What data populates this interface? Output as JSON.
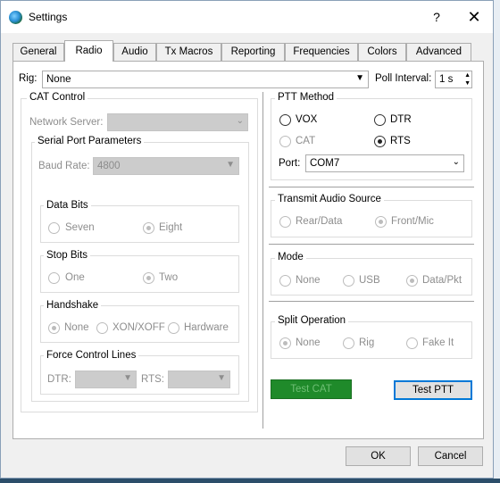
{
  "window": {
    "title": "Settings",
    "help": "?",
    "close": "✕"
  },
  "tabs": [
    "General",
    "Radio",
    "Audio",
    "Tx Macros",
    "Reporting",
    "Frequencies",
    "Colors",
    "Advanced"
  ],
  "rig": {
    "label": "Rig:",
    "value": "None"
  },
  "poll": {
    "label": "Poll Interval:",
    "value": "1 s"
  },
  "cat": {
    "title": "CAT Control",
    "network_label": "Network Server:",
    "serial_title": "Serial Port Parameters",
    "baud_label": "Baud Rate:",
    "baud_value": "4800",
    "data_bits": {
      "title": "Data Bits",
      "opt1": "Seven",
      "opt2": "Eight"
    },
    "stop_bits": {
      "title": "Stop Bits",
      "opt1": "One",
      "opt2": "Two"
    },
    "handshake": {
      "title": "Handshake",
      "opt1": "None",
      "opt2": "XON/XOFF",
      "opt3": "Hardware"
    },
    "force": {
      "title": "Force Control Lines",
      "dtr": "DTR:",
      "rts": "RTS:"
    }
  },
  "ptt": {
    "title": "PTT Method",
    "vox": "VOX",
    "dtr": "DTR",
    "cat": "CAT",
    "rts": "RTS",
    "port_label": "Port:",
    "port_value": "COM7"
  },
  "audio_source": {
    "title": "Transmit Audio Source",
    "opt1": "Rear/Data",
    "opt2": "Front/Mic"
  },
  "mode": {
    "title": "Mode",
    "opt1": "None",
    "opt2": "USB",
    "opt3": "Data/Pkt"
  },
  "split": {
    "title": "Split Operation",
    "opt1": "None",
    "opt2": "Rig",
    "opt3": "Fake It"
  },
  "buttons": {
    "test_cat": "Test CAT",
    "test_ptt": "Test PTT",
    "ok": "OK",
    "cancel": "Cancel"
  },
  "colors": {
    "test_cat_bg": "#1f8a2a",
    "selected_border": "#0078d7"
  }
}
